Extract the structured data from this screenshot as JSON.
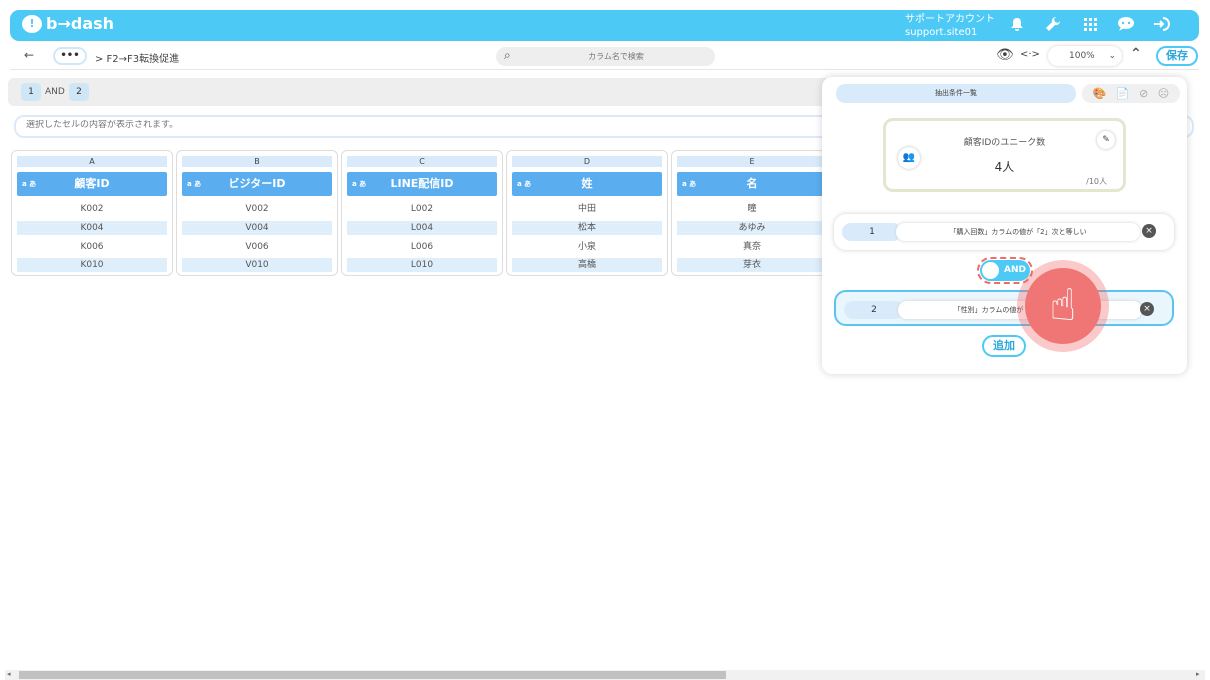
{
  "app": {
    "brand": "b→dash",
    "logo_glyph": "!",
    "account_title": "サポートアカウント",
    "account_id": "support.site01",
    "icons": [
      "bell-icon",
      "wrench-icon",
      "grid-icon",
      "chat-icon",
      "logout-icon"
    ],
    "accent": "#4dc9f6"
  },
  "toolbar": {
    "back": "←",
    "more": "•••",
    "breadcrumb": "> F2→F3転換促進",
    "search_placeholder": "カラム名で検索",
    "eye_icon": "👁",
    "code_icon": "<·>",
    "zoom": "100%",
    "zoom_chevron": "⌄",
    "collapse": "⌃",
    "save": "保存"
  },
  "conditions_strip": {
    "first": "1",
    "op": "AND",
    "second": "2"
  },
  "cell_bar": {
    "placeholder": "選択したセルの内容が表示されます。"
  },
  "type_badge": "a あ",
  "columns": [
    {
      "letter": "A",
      "header": "顧客ID",
      "rows": [
        "K002",
        "K004",
        "K006",
        "K010"
      ]
    },
    {
      "letter": "B",
      "header": "ビジターID",
      "rows": [
        "V002",
        "V004",
        "V006",
        "V010"
      ]
    },
    {
      "letter": "C",
      "header": "LINE配信ID",
      "rows": [
        "L002",
        "L004",
        "L006",
        "L010"
      ]
    },
    {
      "letter": "D",
      "header": "姓",
      "rows": [
        "中田",
        "松本",
        "小泉",
        "高橋"
      ]
    },
    {
      "letter": "E",
      "header": "名",
      "rows": [
        "瞳",
        "あゆみ",
        "真奈",
        "芽衣"
      ]
    }
  ],
  "panel": {
    "title": "抽出条件一覧",
    "tool_icons": [
      "🎨",
      "📄",
      "⊘",
      "☹"
    ],
    "unique": {
      "label": "顧客IDのユニーク数",
      "value": "4人",
      "total": "/10人",
      "group_icon": "👥",
      "edit_icon": "✎"
    },
    "conditions": [
      {
        "num": "1",
        "text": "「購入回数」カラムの値が「2」次と等しい",
        "remove": "×"
      },
      {
        "num": "2",
        "text": "「性別」カラムの値が「女性」次と等しい",
        "remove": "×"
      }
    ],
    "toggle": "AND",
    "add": "追加"
  },
  "pointer": {
    "glyph": "☝"
  },
  "scroll": {
    "left": "◂",
    "right": "▸"
  }
}
